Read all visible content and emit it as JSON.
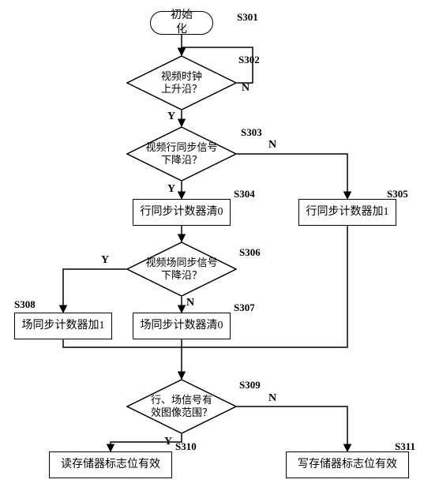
{
  "nodes": {
    "start": "初始化",
    "d1": "视频时钟\n上升沿？",
    "d2": "视频行同步信号\n下降沿？",
    "p_clear_h": "行同步计数器清0",
    "p_inc_h": "行同步计数器加1",
    "d3": "视频场同步信号\n下降沿？",
    "p_clear_v": "场同步计数器清0",
    "p_inc_v": "场同步计数器加1",
    "d4": "行、场信号有\n效图像范围？",
    "p_read": "读存储器标志位有效",
    "p_write": "写存储器标志位有效"
  },
  "labels": {
    "s301": "S301",
    "s302": "S302",
    "s303": "S303",
    "s304": "S304",
    "s305": "S305",
    "s306": "S306",
    "s307": "S307",
    "s308": "S308",
    "s309": "S309",
    "s310": "S310",
    "s311": "S311"
  },
  "branches": {
    "y": "Y",
    "n": "N"
  },
  "chart_data": {
    "type": "flowchart",
    "title": "",
    "nodes": [
      {
        "id": "S301",
        "type": "terminator",
        "text": "初始化"
      },
      {
        "id": "S302",
        "type": "decision",
        "text": "视频时钟上升沿？"
      },
      {
        "id": "S303",
        "type": "decision",
        "text": "视频行同步信号下降沿？"
      },
      {
        "id": "S304",
        "type": "process",
        "text": "行同步计数器清0"
      },
      {
        "id": "S305",
        "type": "process",
        "text": "行同步计数器加1"
      },
      {
        "id": "S306",
        "type": "decision",
        "text": "视频场同步信号下降沿？"
      },
      {
        "id": "S307",
        "type": "process",
        "text": "场同步计数器清0"
      },
      {
        "id": "S308",
        "type": "process",
        "text": "场同步计数器加1"
      },
      {
        "id": "S309",
        "type": "decision",
        "text": "行、场信号有效图像范围？"
      },
      {
        "id": "S310",
        "type": "process",
        "text": "读存储器标志位有效"
      },
      {
        "id": "S311",
        "type": "process",
        "text": "写存储器标志位有效"
      }
    ],
    "edges": [
      {
        "from": "S301",
        "to": "S302",
        "label": ""
      },
      {
        "from": "S302",
        "to": "S303",
        "label": "Y"
      },
      {
        "from": "S302",
        "to": "S302",
        "label": "N",
        "note": "loop back to self-entry"
      },
      {
        "from": "S303",
        "to": "S304",
        "label": "Y"
      },
      {
        "from": "S303",
        "to": "S305",
        "label": "N"
      },
      {
        "from": "S304",
        "to": "S306",
        "label": ""
      },
      {
        "from": "S305",
        "to": "merge_after_S304_S307",
        "label": ""
      },
      {
        "from": "S306",
        "to": "S307",
        "label": "N"
      },
      {
        "from": "S306",
        "to": "S308",
        "label": "Y"
      },
      {
        "from": "S307",
        "to": "S309",
        "label": ""
      },
      {
        "from": "S308",
        "to": "merge_after_S307",
        "label": ""
      },
      {
        "from": "S309",
        "to": "S310",
        "label": "Y"
      },
      {
        "from": "S309",
        "to": "S311",
        "label": "N"
      }
    ]
  }
}
